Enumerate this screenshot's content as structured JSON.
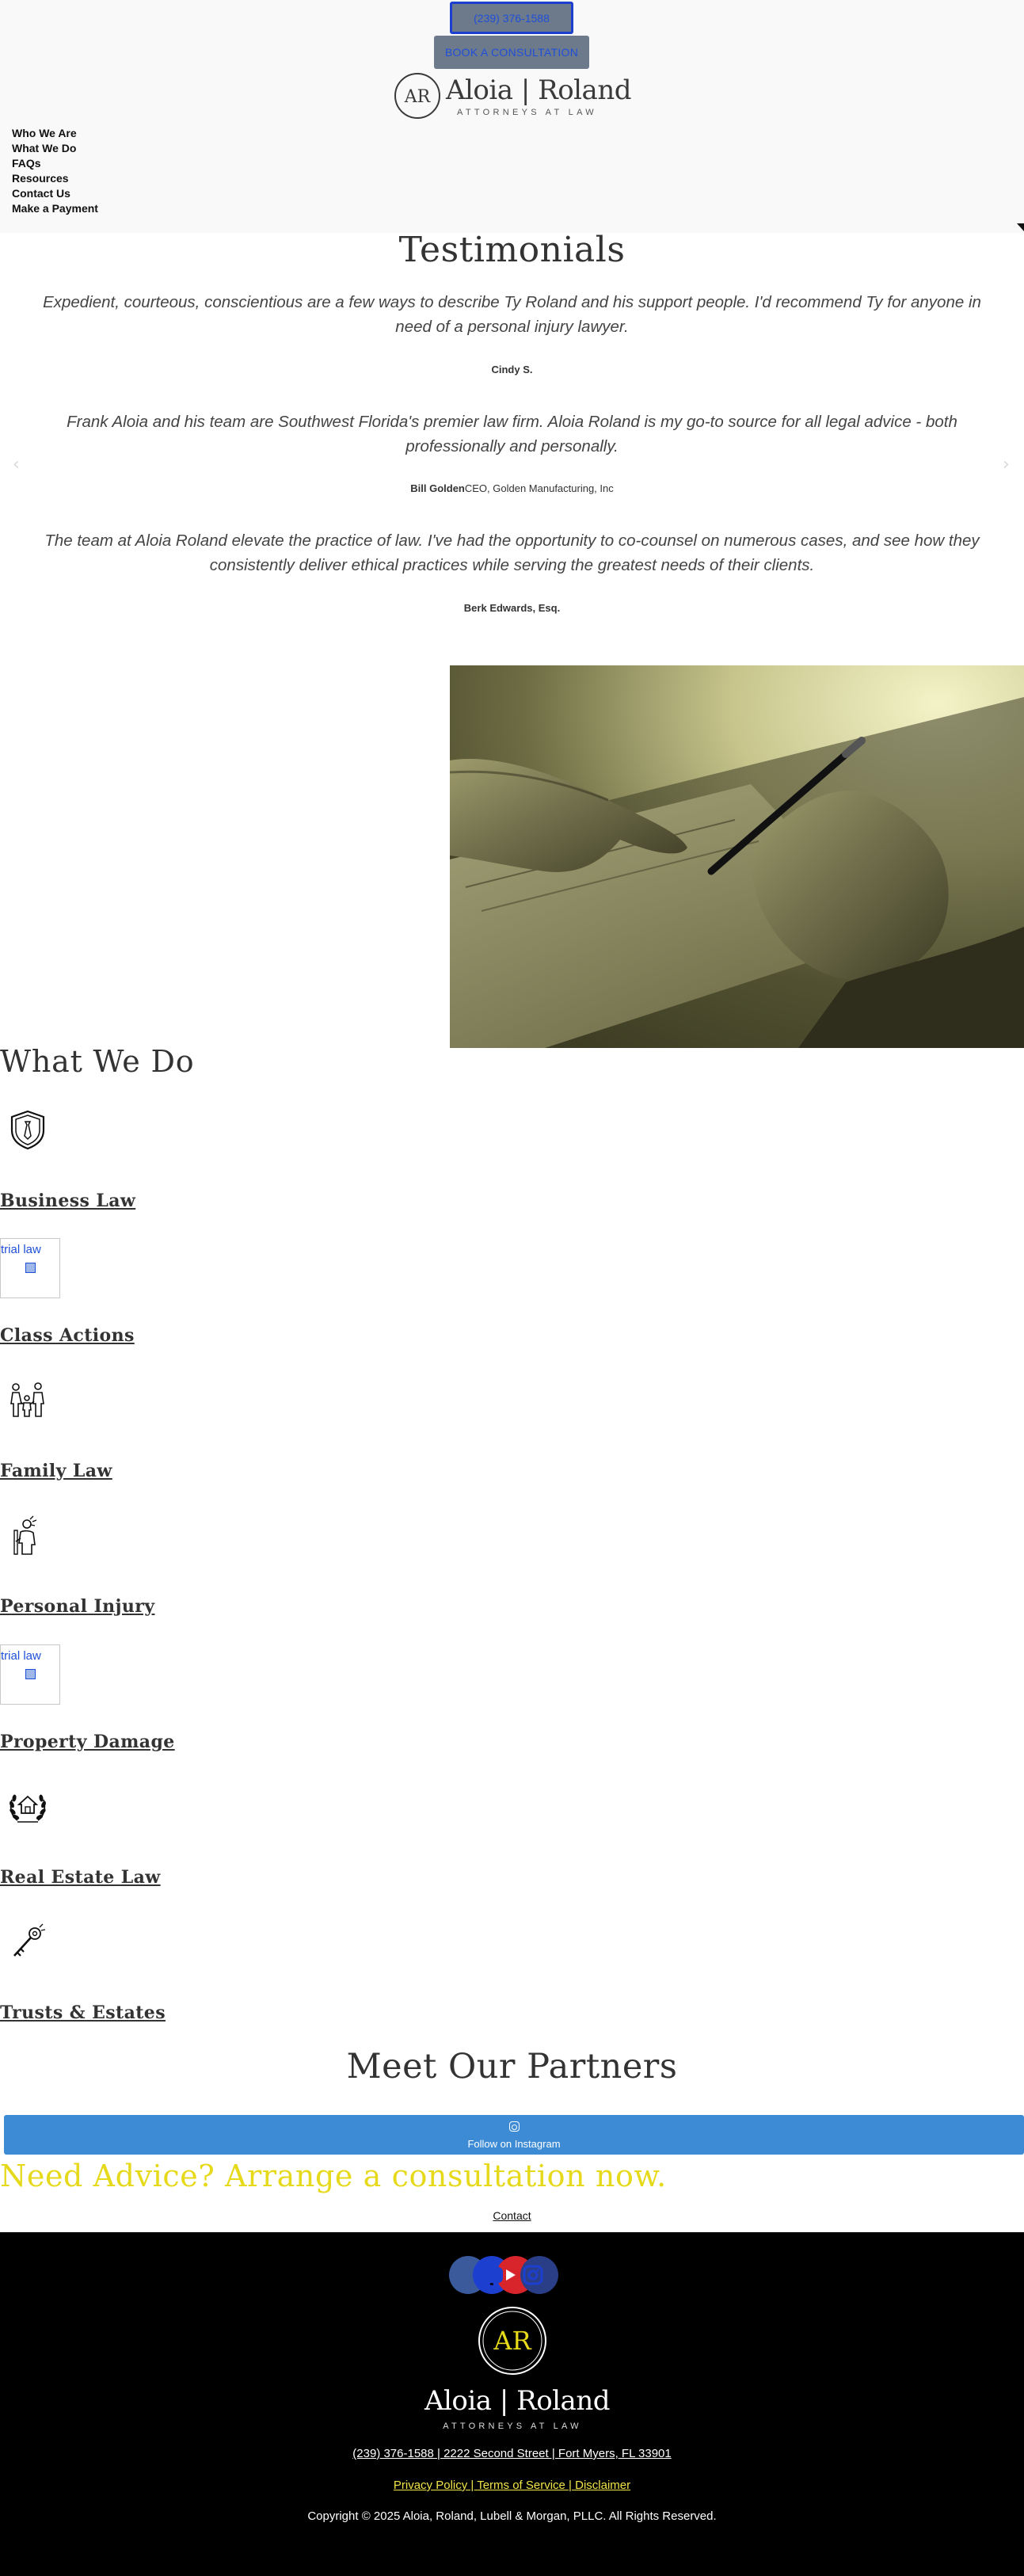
{
  "header": {
    "phone_button": "(239) 376-1588",
    "book_button": "BOOK A CONSULTATION",
    "logo": {
      "name": "Aloia | Roland",
      "tagline": "ATTORNEYS AT LAW",
      "monogram": "AR"
    },
    "nav": [
      "Who We Are",
      "What We Do",
      "FAQs",
      "Resources",
      "Contact Us",
      "Make a Payment"
    ]
  },
  "testimonials": {
    "title": "Testimonials",
    "items": [
      {
        "quote": "Expedient, courteous, conscientious are a few ways to describe Ty Roland and his support people.  I'd recommend Ty for anyone in need of a personal injury lawyer.",
        "author": "Cindy S.",
        "role": ""
      },
      {
        "quote": "Frank Aloia and his team are Southwest Florida's premier law firm.  Aloia Roland is my go-to source for all legal advice - both professionally and personally.",
        "author": "Bill Golden",
        "role": "CEO, Golden Manufacturing, Inc"
      },
      {
        "quote": "The team at Aloia Roland elevate the practice of law.  I've had the opportunity to co-counsel on numerous cases, and see how they consistently deliver ethical practices while serving the greatest needs of their clients.",
        "author": "Berk Edwards, Esq.",
        "role": ""
      }
    ],
    "prev_arrow": "‹",
    "next_arrow": "›"
  },
  "what_we_do": {
    "title": "What We Do",
    "services": [
      {
        "label": "Business Law",
        "icon": "shield-tie-icon"
      },
      {
        "label": "Class Actions",
        "icon": "trial law",
        "broken_image": true
      },
      {
        "label": "Family Law",
        "icon": "family-icon"
      },
      {
        "label": "Personal Injury",
        "icon": "injured-person-icon"
      },
      {
        "label": "Property Damage",
        "icon": "trial law",
        "broken_image": true
      },
      {
        "label": "Real Estate Law",
        "icon": "house-laurel-icon"
      },
      {
        "label": "Trusts & Estates",
        "icon": "key-icon"
      }
    ]
  },
  "partners": {
    "title": "Meet Our Partners"
  },
  "instagram": {
    "label": "Follow on Instagram"
  },
  "cta": {
    "headline": "Need Advice? Arrange a consultation now.",
    "contact_link": "Contact"
  },
  "footer": {
    "social": [
      "avvo-icon",
      "facebook-icon",
      "youtube-icon",
      "instagram-icon"
    ],
    "logo": {
      "name": "Aloia | Roland",
      "tagline": "ATTORNEYS AT LAW",
      "monogram": "AR"
    },
    "address": "(239) 376-1588  | 2222 Second Street  | Fort Myers, FL 33901",
    "legal": "Privacy Policy  | Terms of Service  | Disclaimer",
    "copyright": "Copyright © 2025 Aloia, Roland, Lubell & Morgan, PLLC. All Rights Reserved."
  },
  "colors": {
    "accent_yellow": "#e6d91a",
    "instagram_blue": "#3d8bd4",
    "footer_bg": "#000000"
  }
}
